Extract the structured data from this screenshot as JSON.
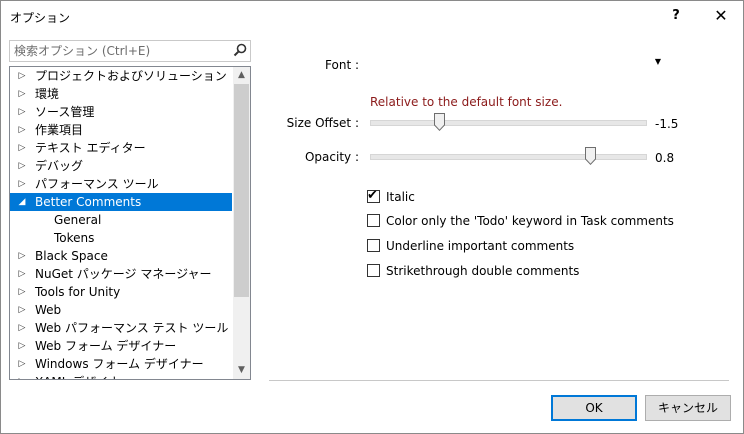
{
  "window": {
    "title": "オプション",
    "help_glyph": "?",
    "close_glyph": "✕"
  },
  "search": {
    "placeholder": "検索オプション (Ctrl+E)"
  },
  "tree": {
    "items": [
      {
        "label": "プロジェクトおよびソリューション",
        "expander": "▷",
        "level": 0,
        "selected": false
      },
      {
        "label": "環境",
        "expander": "▷",
        "level": 0,
        "selected": false
      },
      {
        "label": "ソース管理",
        "expander": "▷",
        "level": 0,
        "selected": false
      },
      {
        "label": "作業項目",
        "expander": "▷",
        "level": 0,
        "selected": false
      },
      {
        "label": "テキスト エディター",
        "expander": "▷",
        "level": 0,
        "selected": false
      },
      {
        "label": "デバッグ",
        "expander": "▷",
        "level": 0,
        "selected": false
      },
      {
        "label": "パフォーマンス ツール",
        "expander": "▷",
        "level": 0,
        "selected": false
      },
      {
        "label": "Better Comments",
        "expander": "◢",
        "level": 0,
        "selected": true
      },
      {
        "label": "General",
        "expander": "",
        "level": 1,
        "selected": false
      },
      {
        "label": "Tokens",
        "expander": "",
        "level": 1,
        "selected": false
      },
      {
        "label": "Black Space",
        "expander": "▷",
        "level": 0,
        "selected": false
      },
      {
        "label": "NuGet パッケージ マネージャー",
        "expander": "▷",
        "level": 0,
        "selected": false
      },
      {
        "label": "Tools for Unity",
        "expander": "▷",
        "level": 0,
        "selected": false
      },
      {
        "label": "Web",
        "expander": "▷",
        "level": 0,
        "selected": false
      },
      {
        "label": "Web パフォーマンス テスト ツール",
        "expander": "▷",
        "level": 0,
        "selected": false
      },
      {
        "label": "Web フォーム デザイナー",
        "expander": "▷",
        "level": 0,
        "selected": false
      },
      {
        "label": "Windows フォーム デザイナー",
        "expander": "▷",
        "level": 0,
        "selected": false
      },
      {
        "label": "XAML デザイナー",
        "expander": "▷",
        "level": 0,
        "selected": false
      }
    ],
    "scroll_up": "▲",
    "scroll_down": "▼"
  },
  "settings": {
    "font_label": "Font :",
    "font_value": "",
    "font_arrow": "▼",
    "hint": "Relative to the default font size.",
    "size_offset": {
      "label": "Size Offset :",
      "value": "-1.5",
      "position_fraction": 0.25
    },
    "opacity": {
      "label": "Opacity :",
      "value": "0.8",
      "position_fraction": 0.8
    },
    "checkboxes": [
      {
        "label": "Italic",
        "checked": true
      },
      {
        "label": "Color only the 'Todo' keyword in Task comments",
        "checked": false
      },
      {
        "label": "Underline important comments",
        "checked": false
      },
      {
        "label": "Strikethrough double comments",
        "checked": false
      }
    ],
    "check_glyph": "✔"
  },
  "buttons": {
    "ok": "OK",
    "cancel": "キャンセル"
  },
  "colors": {
    "selection": "#0078d7",
    "hint": "#8b1a1a",
    "default_button_border": "#0078d7"
  }
}
